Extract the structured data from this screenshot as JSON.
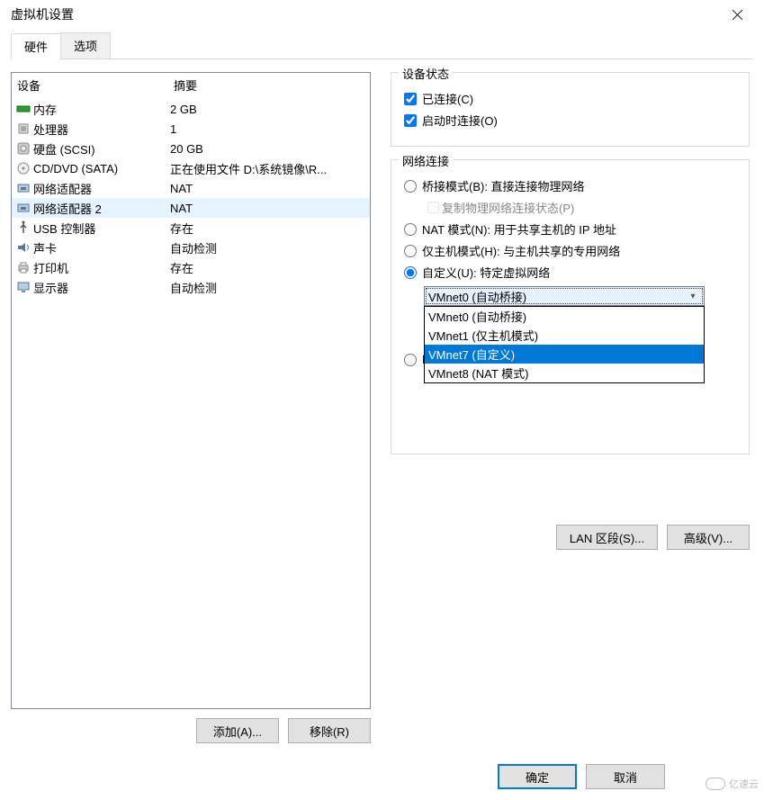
{
  "window": {
    "title": "虚拟机设置"
  },
  "tabs": {
    "hardware": "硬件",
    "options": "选项"
  },
  "deviceList": {
    "header": {
      "device": "设备",
      "summary": "摘要"
    },
    "rows": [
      {
        "name": "内存",
        "summary": "2 GB",
        "icon": "memory"
      },
      {
        "name": "处理器",
        "summary": "1",
        "icon": "cpu"
      },
      {
        "name": "硬盘 (SCSI)",
        "summary": "20 GB",
        "icon": "disk"
      },
      {
        "name": "CD/DVD (SATA)",
        "summary": "正在使用文件 D:\\系统镜像\\R...",
        "icon": "disc"
      },
      {
        "name": "网络适配器",
        "summary": "NAT",
        "icon": "net"
      },
      {
        "name": "网络适配器 2",
        "summary": "NAT",
        "icon": "net",
        "selected": true
      },
      {
        "name": "USB 控制器",
        "summary": "存在",
        "icon": "usb"
      },
      {
        "name": "声卡",
        "summary": "自动检测",
        "icon": "sound"
      },
      {
        "name": "打印机",
        "summary": "存在",
        "icon": "printer"
      },
      {
        "name": "显示器",
        "summary": "自动检测",
        "icon": "monitor"
      }
    ]
  },
  "leftButtons": {
    "add": "添加(A)...",
    "remove": "移除(R)"
  },
  "statusGroup": {
    "title": "设备状态",
    "connected": "已连接(C)",
    "connectAtStart": "启动时连接(O)"
  },
  "netGroup": {
    "title": "网络连接",
    "bridged": "桥接模式(B): 直接连接物理网络",
    "replicate": "复制物理网络连接状态(P)",
    "nat": "NAT 模式(N): 用于共享主机的 IP 地址",
    "hostOnly": "仅主机模式(H): 与主机共享的专用网络",
    "custom": "自定义(U): 特定虚拟网络",
    "combo": {
      "selected": "VMnet0 (自动桥接)",
      "options": [
        "VMnet0 (自动桥接)",
        "VMnet1 (仅主机模式)",
        "VMnet7 (自定义)",
        "VMnet8 (NAT 模式)"
      ],
      "highlightIndex": 2
    },
    "lanSegment": "L"
  },
  "rightButtons": {
    "lan": "LAN 区段(S)...",
    "advanced": "高级(V)..."
  },
  "footer": {
    "ok": "确定",
    "cancel": "取消"
  },
  "watermark": "亿速云"
}
